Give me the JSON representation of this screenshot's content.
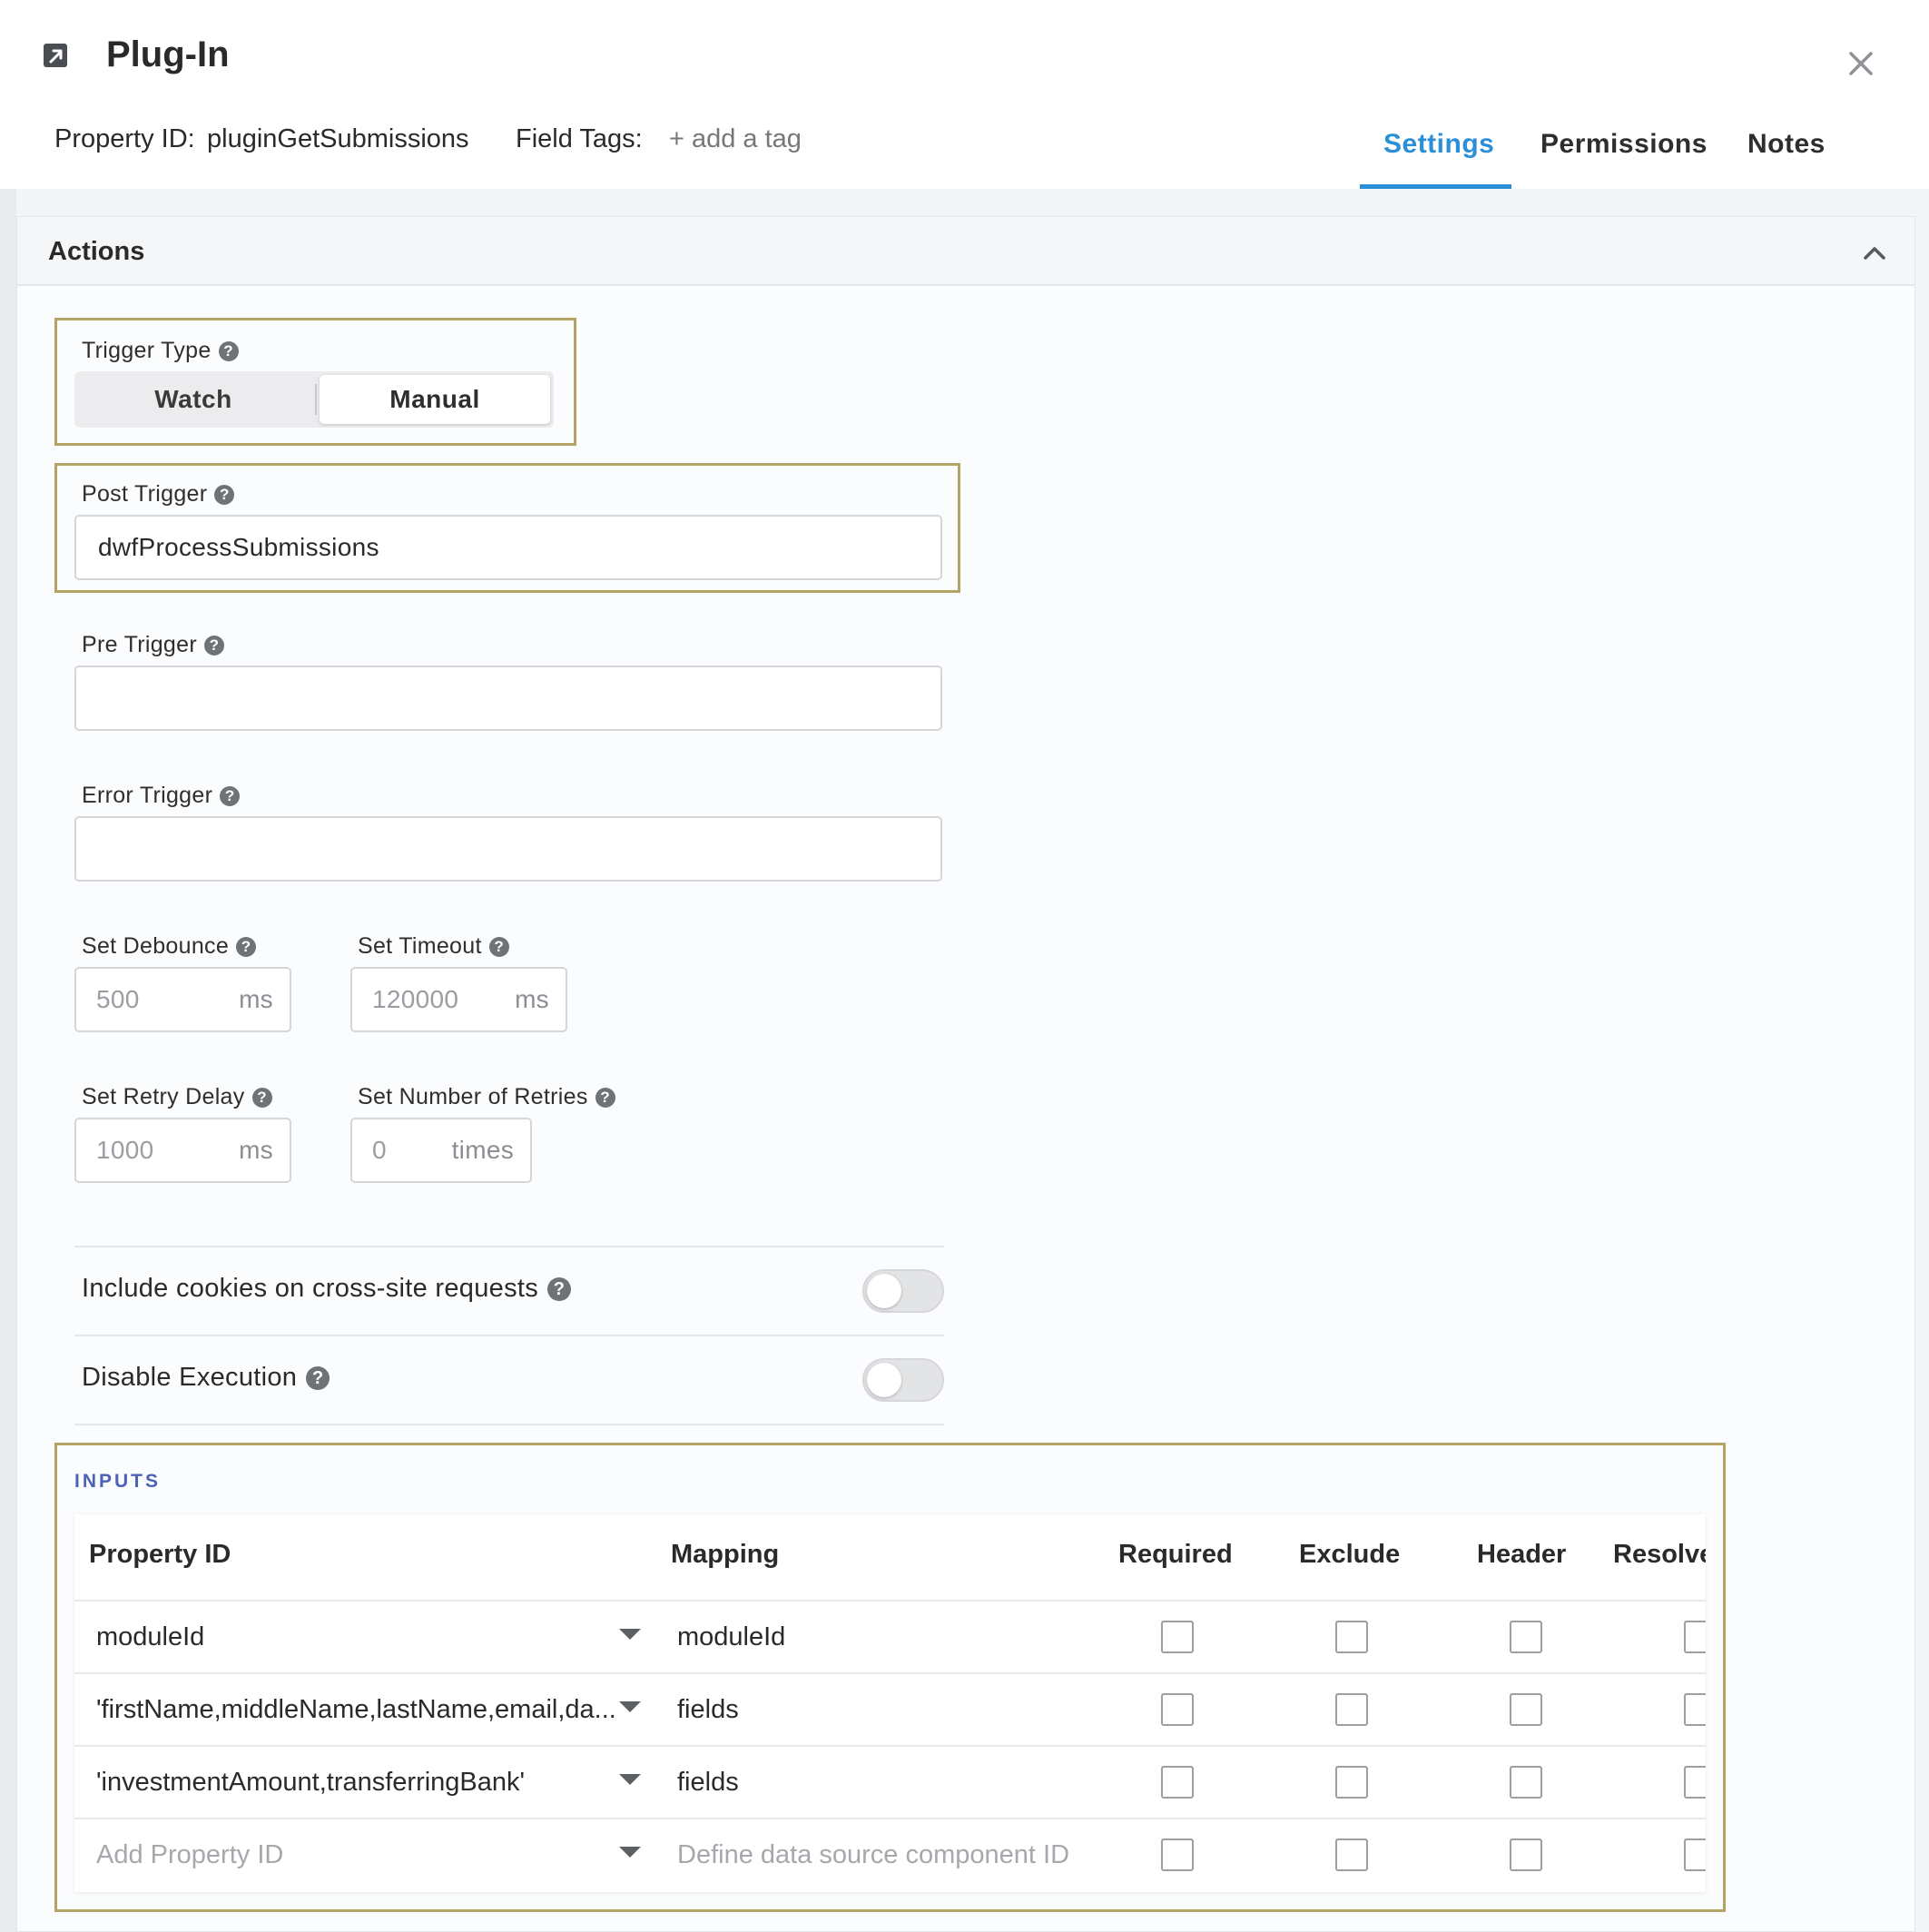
{
  "dialog": {
    "title": "Plug-In",
    "property_id_label": "Property ID:",
    "property_id_value": "pluginGetSubmissions",
    "field_tags_label": "Field Tags:",
    "add_tag_label": "+ add a tag",
    "tabs": [
      {
        "label": "Settings",
        "active": true
      },
      {
        "label": "Permissions",
        "active": false
      },
      {
        "label": "Notes",
        "active": false
      }
    ],
    "accent_color": "#2b8fd8",
    "highlight_color": "#b5a265"
  },
  "actions": {
    "title": "Actions",
    "trigger_type": {
      "label": "Trigger Type",
      "options": [
        "Watch",
        "Manual"
      ],
      "selected": "Manual"
    },
    "post_trigger": {
      "label": "Post Trigger",
      "value": "dwfProcessSubmissions"
    },
    "pre_trigger": {
      "label": "Pre Trigger",
      "value": ""
    },
    "error_trigger": {
      "label": "Error Trigger",
      "value": ""
    },
    "debounce": {
      "label": "Set Debounce",
      "value": "500",
      "unit": "ms"
    },
    "timeout": {
      "label": "Set Timeout",
      "value": "120000",
      "unit": "ms"
    },
    "retry_delay": {
      "label": "Set Retry Delay",
      "value": "1000",
      "unit": "ms"
    },
    "retries": {
      "label": "Set Number of Retries",
      "value": "0",
      "unit": "times"
    },
    "include_cookies": {
      "label": "Include cookies on cross-site requests",
      "on": false
    },
    "disable_execution": {
      "label": "Disable Execution",
      "on": false
    }
  },
  "inputs": {
    "title": "INPUTS",
    "columns": [
      "Property ID",
      "Mapping",
      "Required",
      "Exclude",
      "Header",
      "Resolve"
    ],
    "rows": [
      {
        "property_id": "moduleId",
        "mapping": "moduleId"
      },
      {
        "property_id": "'firstName,middleName,lastName,email,da...",
        "mapping": "fields"
      },
      {
        "property_id": "'investmentAmount,transferringBank'",
        "mapping": "fields"
      }
    ],
    "new_row": {
      "property_placeholder": "Add Property ID",
      "mapping_placeholder": "Define data source component ID"
    }
  }
}
